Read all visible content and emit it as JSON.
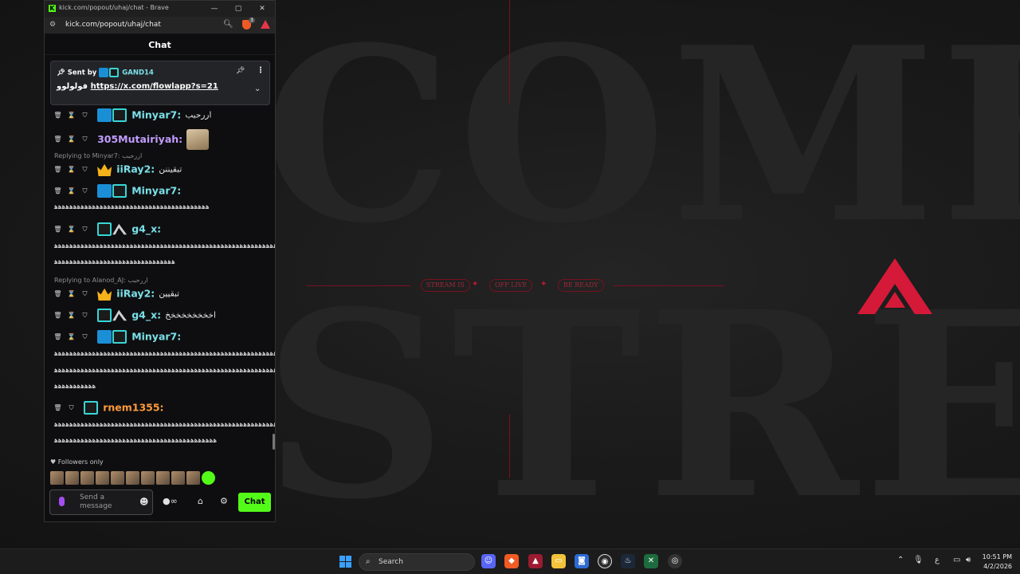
{
  "wallpaper": {
    "word_top": "COME",
    "word_bottom": "STREA",
    "pills": [
      "STREAM IS",
      "OFF LIVE",
      "BE READY"
    ],
    "accent": "#c0172f"
  },
  "browser": {
    "title": "kick.com/popout/uhaj/chat - Brave",
    "url": "kick.com/popout/uhaj/chat",
    "shield_count": "3",
    "favicon": "K"
  },
  "chat": {
    "header": "Chat",
    "pinned": {
      "sent_by": "Sent by",
      "username": "GAND14",
      "prefix": "فولولوو",
      "link": "https://x.com/flowlapp?s=21"
    },
    "messages": [
      {
        "user": "Minyar7:",
        "text": "اررحبب"
      },
      {
        "user": "305Mutairiyah:",
        "text": ""
      },
      {
        "reply": "Replying to Minyar7: اررحبب",
        "user": "iiRay2:",
        "text": "تبقيننن"
      },
      {
        "user": "Minyar7:",
        "text": "",
        "wrap": [
          "ﻫﻫﻫﻫﻫﻫﻫﻫﻫﻫﻫﻫﻫﻫﻫﻫﻫﻫﻫﻫﻫﻫﻫﻫﻫﻫﻫﻫﻫﻫﻫﻫﻫﻫﻫﻫﻫﻫﻫﻫﻫ"
        ]
      },
      {
        "user": "g4_x:",
        "text": "",
        "wrap": [
          "ﻫﻫﻫﻫﻫﻫﻫﻫﻫﻫﻫﻫﻫﻫﻫﻫﻫﻫﻫﻫﻫﻫﻫﻫﻫﻫﻫﻫﻫﻫﻫﻫﻫﻫﻫﻫﻫﻫﻫﻫﻫﻫﻫﻫﻫﻫﻫﻫﻫﻫﻫﻫﻫﻫﻫﻫﻫﻫﻫﻫ",
          "ﻫﻫﻫﻫﻫﻫﻫﻫﻫﻫﻫﻫﻫﻫﻫﻫﻫﻫﻫﻫﻫﻫﻫﻫﻫﻫﻫﻫﻫﻫﻫﻫ"
        ]
      },
      {
        "reply": "Replying to Alanod_AJ: اررحبب",
        "user": "iiRay2:",
        "text": "تبقيين"
      },
      {
        "user": "g4_x:",
        "text": "اخخخخخخخخخ"
      },
      {
        "user": "Minyar7:",
        "text": "",
        "wrap": [
          "ﻫﻫﻫﻫﻫﻫﻫﻫﻫﻫﻫﻫﻫﻫﻫﻫﻫﻫﻫﻫﻫﻫﻫﻫﻫﻫﻫﻫﻫﻫﻫﻫﻫﻫﻫﻫﻫﻫﻫﻫﻫﻫﻫﻫﻫﻫﻫﻫﻫﻫﻫﻫﻫﻫﻫﻫﻫﻫﻫﻫ",
          "ﻫﻫﻫﻫﻫﻫﻫﻫﻫﻫﻫﻫﻫﻫﻫﻫﻫﻫﻫﻫﻫﻫﻫﻫﻫﻫﻫﻫﻫﻫﻫﻫﻫﻫﻫﻫﻫﻫﻫﻫﻫﻫﻫﻫﻫﻫﻫﻫﻫﻫﻫﻫﻫﻫﻫﻫﻫﻫﻫﻫ",
          "ﻫﻫﻫﻫﻫﻫﻫﻫﻫﻫﻫ"
        ]
      },
      {
        "user": "rnem1355:",
        "text": "",
        "wrap": [
          "ﻫﻫﻫﻫﻫﻫﻫﻫﻫﻫﻫﻫﻫﻫﻫﻫﻫﻫﻫﻫﻫﻫﻫﻫﻫﻫﻫﻫﻫﻫﻫﻫﻫﻫﻫﻫﻫﻫﻫﻫﻫﻫﻫﻫﻫﻫﻫﻫﻫﻫﻫﻫﻫﻫﻫﻫﻫﻫﻫﻫ",
          "ﻫﻫﻫﻫﻫﻫﻫﻫﻫﻫﻫﻫﻫﻫﻫﻫﻫﻫﻫﻫﻫﻫﻫﻫﻫﻫﻫﻫﻫﻫﻫﻫﻫﻫﻫﻫﻫﻫﻫﻫﻫﻫﻫ"
        ]
      }
    ],
    "followers_only": "Followers only",
    "input_placeholder": "Send a message",
    "chat_button": "Chat",
    "brand_color": "#53fc18"
  },
  "taskbar": {
    "search_label": "Search",
    "time": "10:51 PM",
    "date": "4/2/2026",
    "ime": "ع"
  }
}
